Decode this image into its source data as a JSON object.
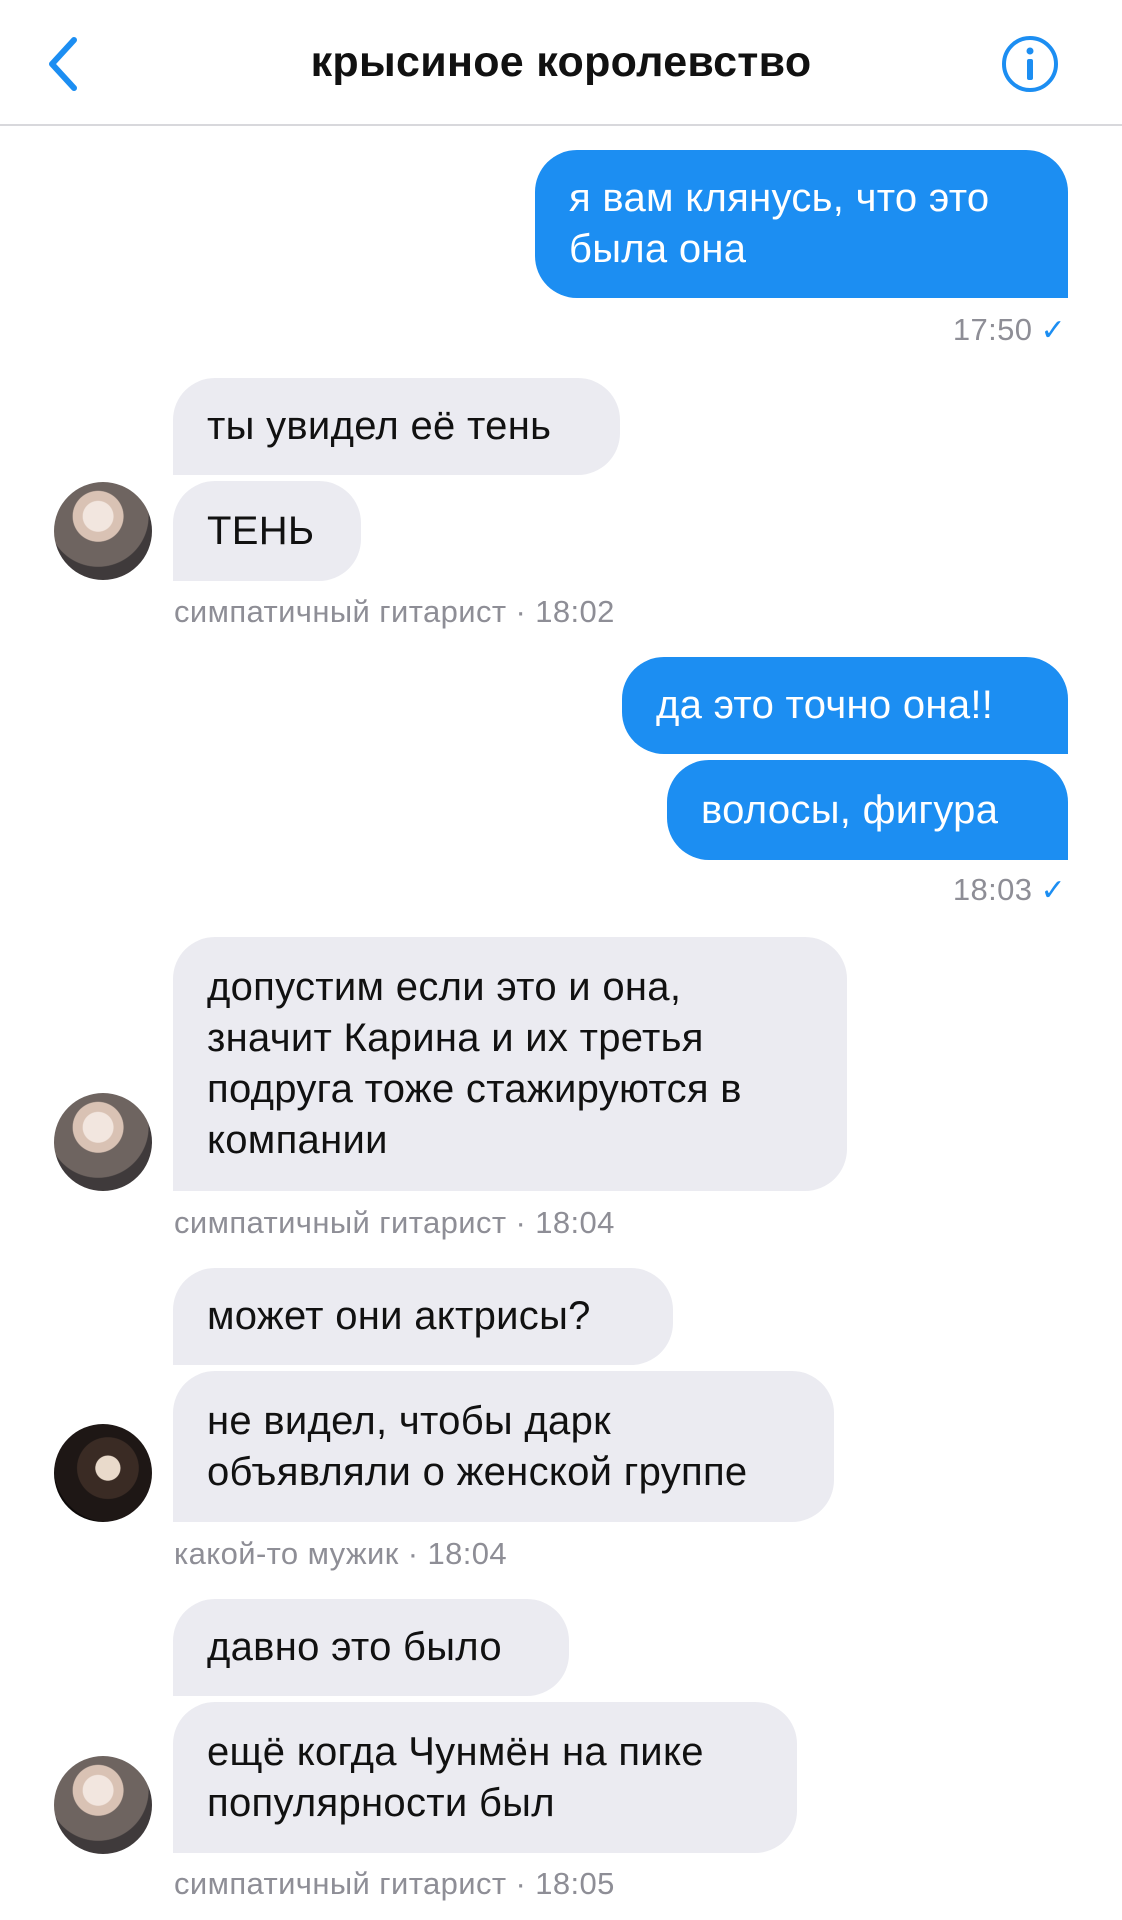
{
  "header": {
    "title": "крысиное королевство",
    "back_icon": "chevron-left-icon",
    "info_icon": "info-circle-icon",
    "accent_color": "#1c8ef2"
  },
  "messages": {
    "m1": {
      "text": "я вам клянусь, что это\nбыла она",
      "time": "17:50",
      "status": "read"
    },
    "m2": {
      "text": "ты увидел её тень"
    },
    "m3": {
      "text": "ТЕНЬ",
      "sender": "симпатичный гитарист · 18:02"
    },
    "m4": {
      "text": "да это точно она!!"
    },
    "m5": {
      "text": "волосы, фигура",
      "time": "18:03",
      "status": "read"
    },
    "m6": {
      "text": "допустим если это и она,\nзначит Карина и их третья\nподруга тоже стажируются в\nкомпании",
      "sender": "симпатичный гитарист · 18:04"
    },
    "m7": {
      "text": "может они актрисы?"
    },
    "m8": {
      "text": "не видел, чтобы дарк\nобъявляли о женской группе",
      "sender": "какой-то мужик · 18:04"
    },
    "m9": {
      "text": "давно это было"
    },
    "m10": {
      "text": "ещё когда Чунмён на пике\nпопулярности был",
      "sender": "симпатичный гитарист · 18:05"
    }
  },
  "check_mark": "✓"
}
